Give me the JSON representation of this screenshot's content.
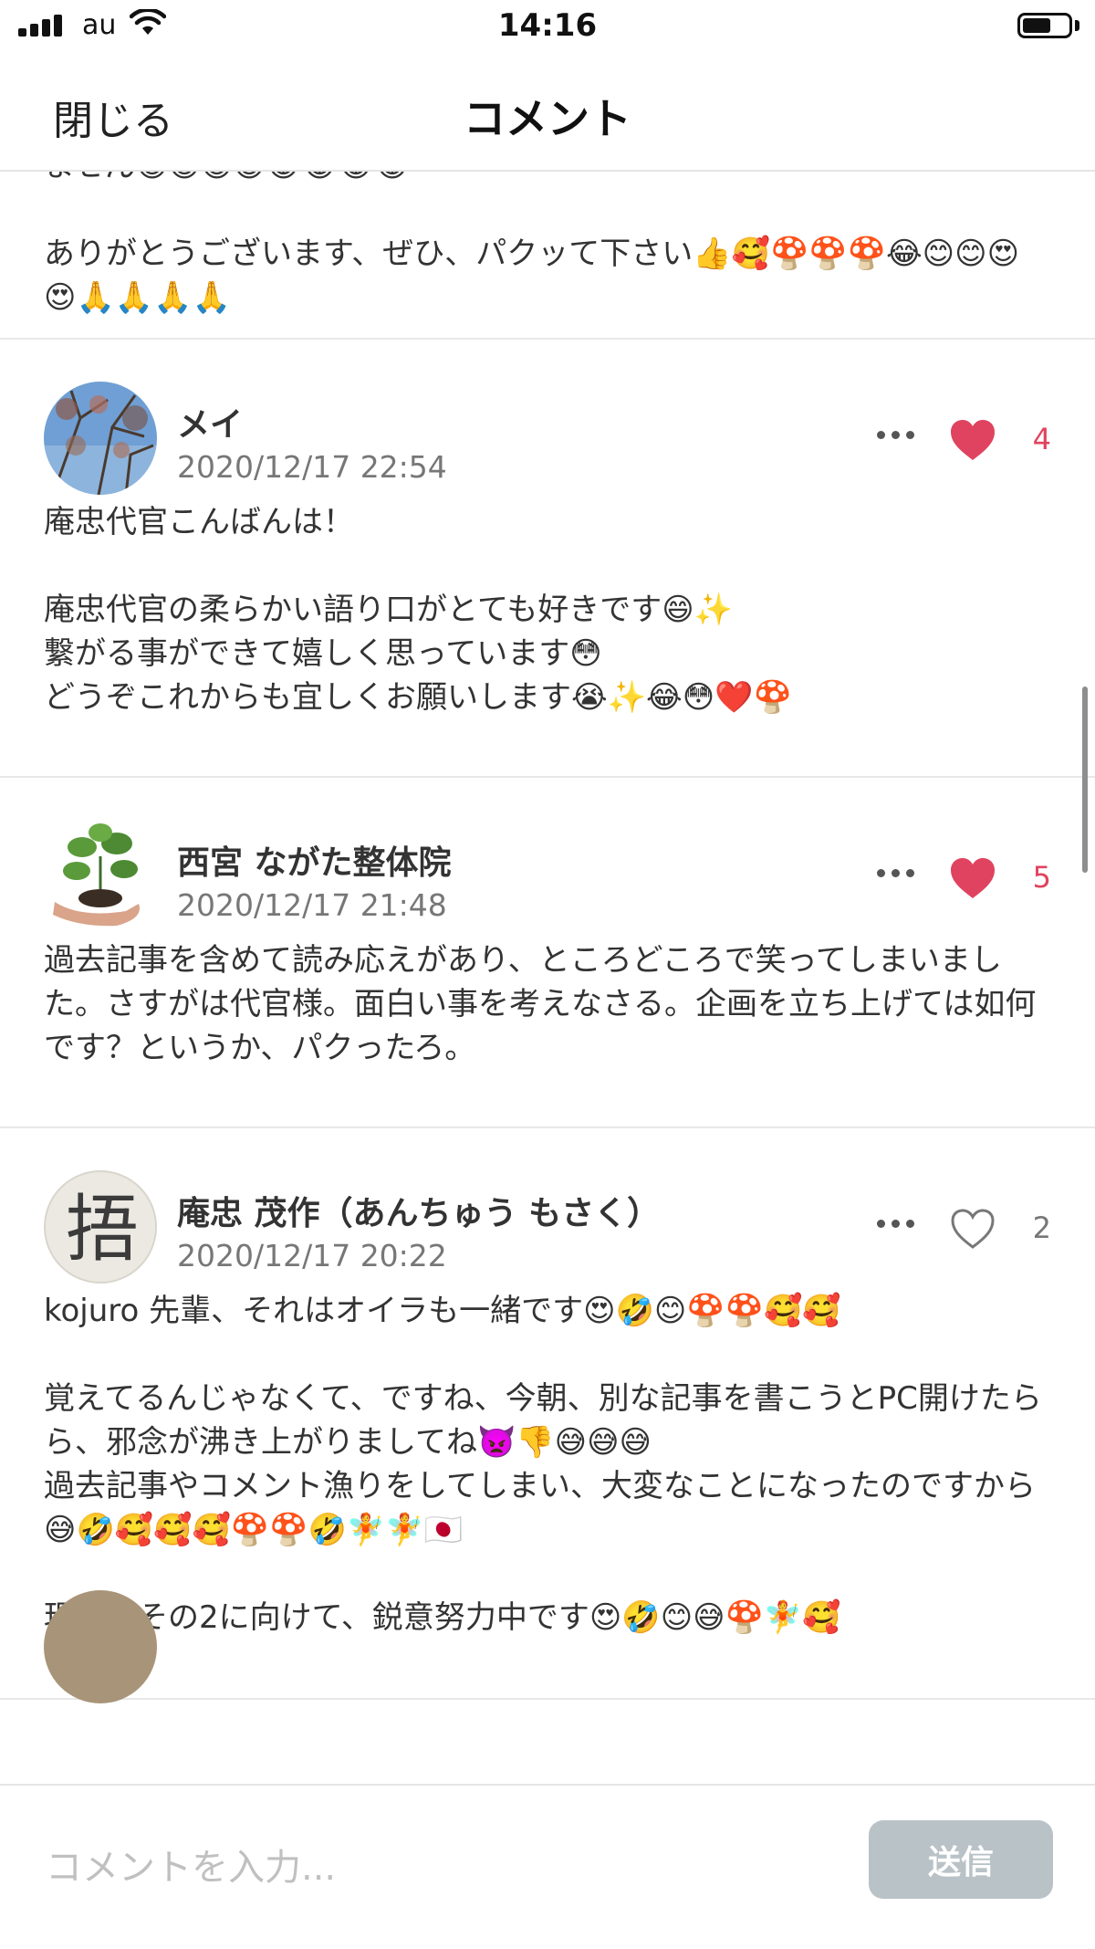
{
  "status_bar": {
    "carrier": "au",
    "time": "14:16"
  },
  "header": {
    "close_label": "閉じる",
    "title": "コメント"
  },
  "comments": [
    {
      "partial": true,
      "body": "ません😅😅😅😅😂😂😂😂\n\nありがとうございます、ぜひ、パクッて下さい👍🥰🍄🍄🍄😂😊😊😍😍🙏🙏🙏🙏"
    },
    {
      "author": "メイ",
      "timestamp": "2020/12/17 22:54",
      "likes": "4",
      "liked": true,
      "body": "庵忠代官こんばんは！\n\n庵忠代官の柔らかい語り口がとても好きです😄✨\n繋がる事ができて嬉しく思っています😳\nどうぞこれからも宜しくお願いします😭✨😂😳❤️🍄"
    },
    {
      "author": "西宮 ながた整体院",
      "timestamp": "2020/12/17 21:48",
      "likes": "5",
      "liked": true,
      "body": "過去記事を含めて読み応えがあり、ところどころで笑ってしまいました。さすがは代官様。面白い事を考えなさる。企画を立ち上げては如何です？というか、パクったろ。"
    },
    {
      "author": "庵忠 茂作（あんちゅう もさく）",
      "timestamp": "2020/12/17 20:22",
      "likes": "2",
      "liked": false,
      "avatar_glyph": "捂",
      "body": "kojuro 先輩、それはオイラも一緒です😍🤣😊🍄🍄🥰🥰\n\n覚えてるんじゃなくて、ですね、今朝、別な記事を書こうとPC開けたらら、邪念が沸き上がりましてね👿👎😅😅😅\n過去記事やコメント漁りをしてしまい、大変なことになったのですから😅🤣🥰🥰🥰🍄🍄🤣🧚🧚🇯🇵\n\n現在、その2に向けて、鋭意努力中です😍🤣😊😅🍄🧚🥰"
    }
  ],
  "composer": {
    "placeholder": "コメントを入力...",
    "send_label": "送信"
  },
  "colors": {
    "like_active": "#e0435f",
    "send_disabled": "#b9c2c7"
  }
}
